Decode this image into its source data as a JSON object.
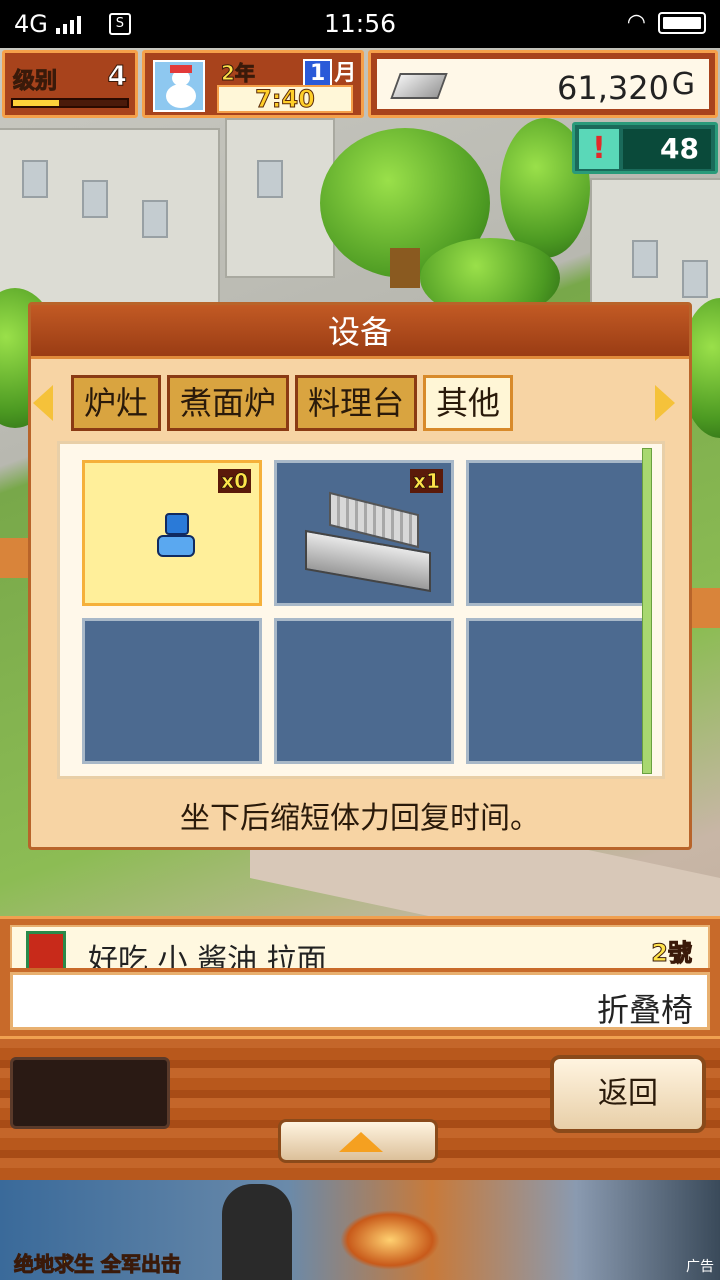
{
  "status_bar": {
    "network": "4G",
    "time": "11:56"
  },
  "hud": {
    "level_label": "级别",
    "level_value": "4",
    "level_progress_pct": 40,
    "year": "2年",
    "month_num": "1",
    "month_unit": "月",
    "clock": "7:40",
    "money": "61,320",
    "currency": "G",
    "alert_count": "48"
  },
  "dialog": {
    "title": "设备",
    "tabs": [
      "炉灶",
      "煮面炉",
      "料理台",
      "其他"
    ],
    "active_tab_index": 3,
    "items": [
      {
        "count": "x0",
        "icon": "chair-icon",
        "selected": true
      },
      {
        "count": "x1",
        "icon": "sink-icon",
        "selected": false
      },
      {
        "count": "",
        "icon": "",
        "selected": false
      },
      {
        "count": "",
        "icon": "",
        "selected": false
      },
      {
        "count": "",
        "icon": "",
        "selected": false
      },
      {
        "count": "",
        "icon": "",
        "selected": false
      }
    ],
    "description": "坐下后缩短体力回复时间。"
  },
  "shop_bar": {
    "name": "好吃 小 酱油 拉面",
    "rank": "2號"
  },
  "selected_item_name": "折叠椅",
  "buttons": {
    "back": "返回"
  },
  "ad": {
    "tagline": "绝地求生 全军出击",
    "label": "广告"
  }
}
